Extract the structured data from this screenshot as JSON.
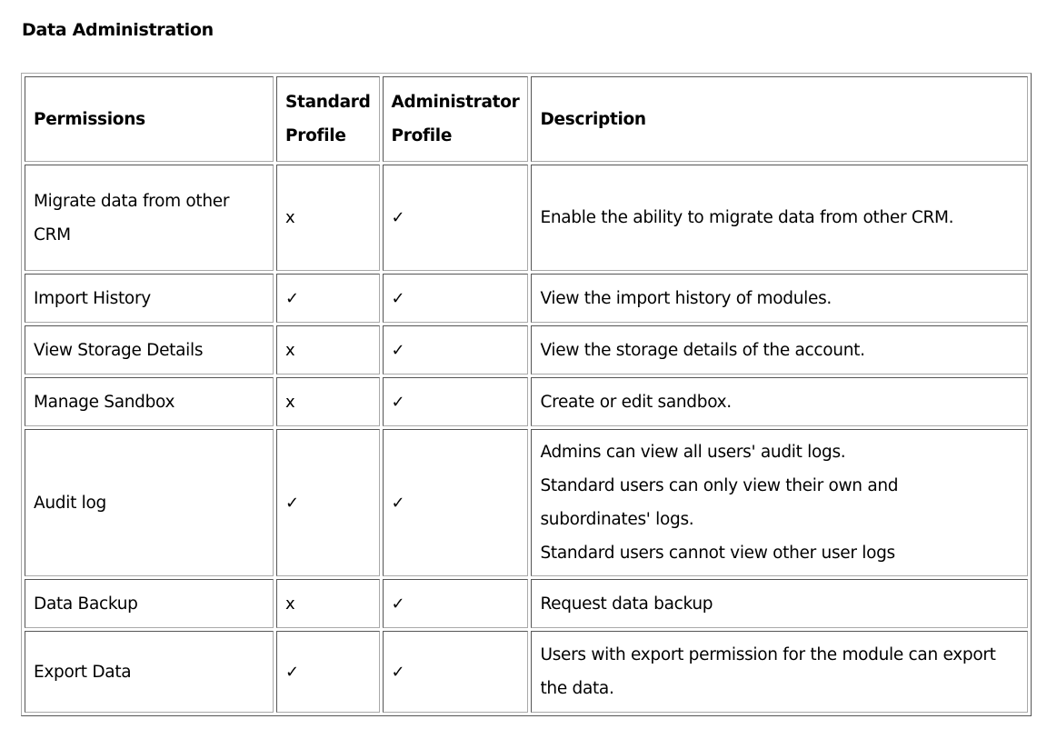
{
  "section_title": "Data Administration",
  "table": {
    "headers": {
      "permissions": "Permissions",
      "standard": [
        "Standard",
        "Profile"
      ],
      "administrator": [
        "Administrator",
        "Profile"
      ],
      "description": "Description"
    },
    "rows": [
      {
        "permission": [
          "Migrate data from other",
          "CRM"
        ],
        "standard": "x",
        "administrator": "✓",
        "description": [
          "Enable the ability to migrate data from other CRM."
        ]
      },
      {
        "permission": [
          "Import History"
        ],
        "standard": "✓",
        "administrator": "✓",
        "description": [
          "View the import history of modules."
        ]
      },
      {
        "permission": [
          "View Storage Details"
        ],
        "standard": "x",
        "administrator": "✓",
        "description": [
          "View the storage details of the account."
        ]
      },
      {
        "permission": [
          "Manage Sandbox"
        ],
        "standard": "x",
        "administrator": "✓",
        "description": [
          "Create or edit sandbox."
        ]
      },
      {
        "permission": [
          "Audit log"
        ],
        "standard": "✓",
        "administrator": "✓",
        "description": [
          "Admins can view all users' audit logs.",
          "Standard users can only view their own and",
          "subordinates' logs.",
          "Standard users cannot view other user logs"
        ]
      },
      {
        "permission": [
          "Data Backup"
        ],
        "standard": "x",
        "administrator": "✓",
        "description": [
          "Request data backup"
        ]
      },
      {
        "permission": [
          "Export Data"
        ],
        "standard": "✓",
        "administrator": "✓",
        "description": [
          "Users with export permission for the module can export",
          "the data."
        ]
      }
    ]
  }
}
